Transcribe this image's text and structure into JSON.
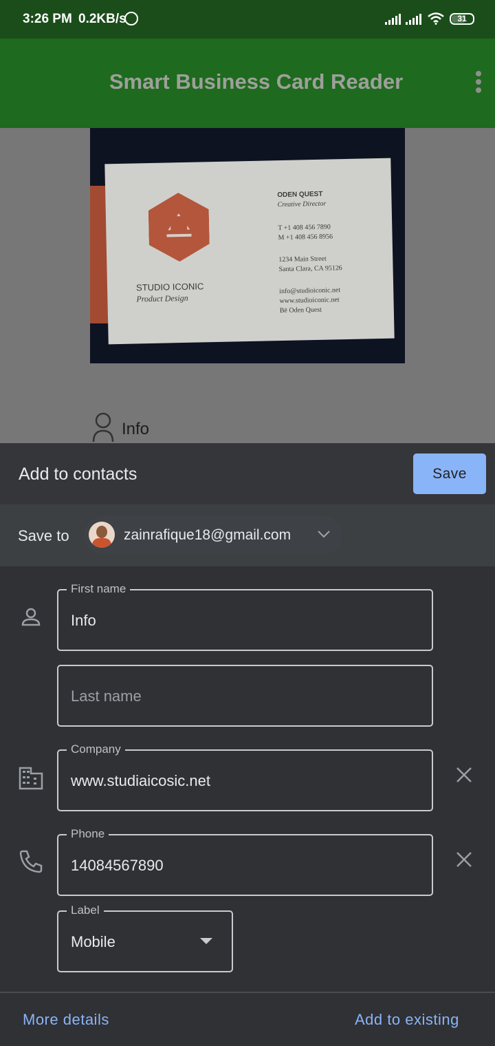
{
  "status_bar": {
    "time": "3:26 PM",
    "net_speed": "0.2KB/s",
    "battery": "31"
  },
  "app": {
    "title": "Smart Business Card Reader",
    "info_label": "Info"
  },
  "business_card": {
    "name": "ODEN QUEST",
    "role": "Creative Director",
    "phone_t": "T  +1 408 456 7890",
    "phone_m": "M  +1 408 456 8956",
    "address1": "1234 Main Street",
    "address2": "Santa Clara, CA 95126",
    "email": "info@studioiconic.net",
    "web": "www.studioiconic.net",
    "handle": "Bē  Oden Quest",
    "company": "STUDIO ICONIC",
    "tagline": "Product Design"
  },
  "sheet": {
    "title": "Add to contacts",
    "save_label": "Save",
    "save_to_label": "Save to",
    "account_email": "zainrafique18@gmail.com"
  },
  "form": {
    "first_name": {
      "label": "First name",
      "value": "Info"
    },
    "last_name": {
      "placeholder": "Last name"
    },
    "company": {
      "label": "Company",
      "value": "www.studiaicosic.net"
    },
    "phone": {
      "label": "Phone",
      "value": "14084567890"
    },
    "phone_label": {
      "label": "Label",
      "value": "Mobile"
    }
  },
  "footer": {
    "more_details": "More details",
    "add_to_existing": "Add to existing"
  },
  "colors": {
    "accent": "#8ab4f8",
    "sheet_bg": "#303134",
    "appbar": "#1e6a1e"
  }
}
